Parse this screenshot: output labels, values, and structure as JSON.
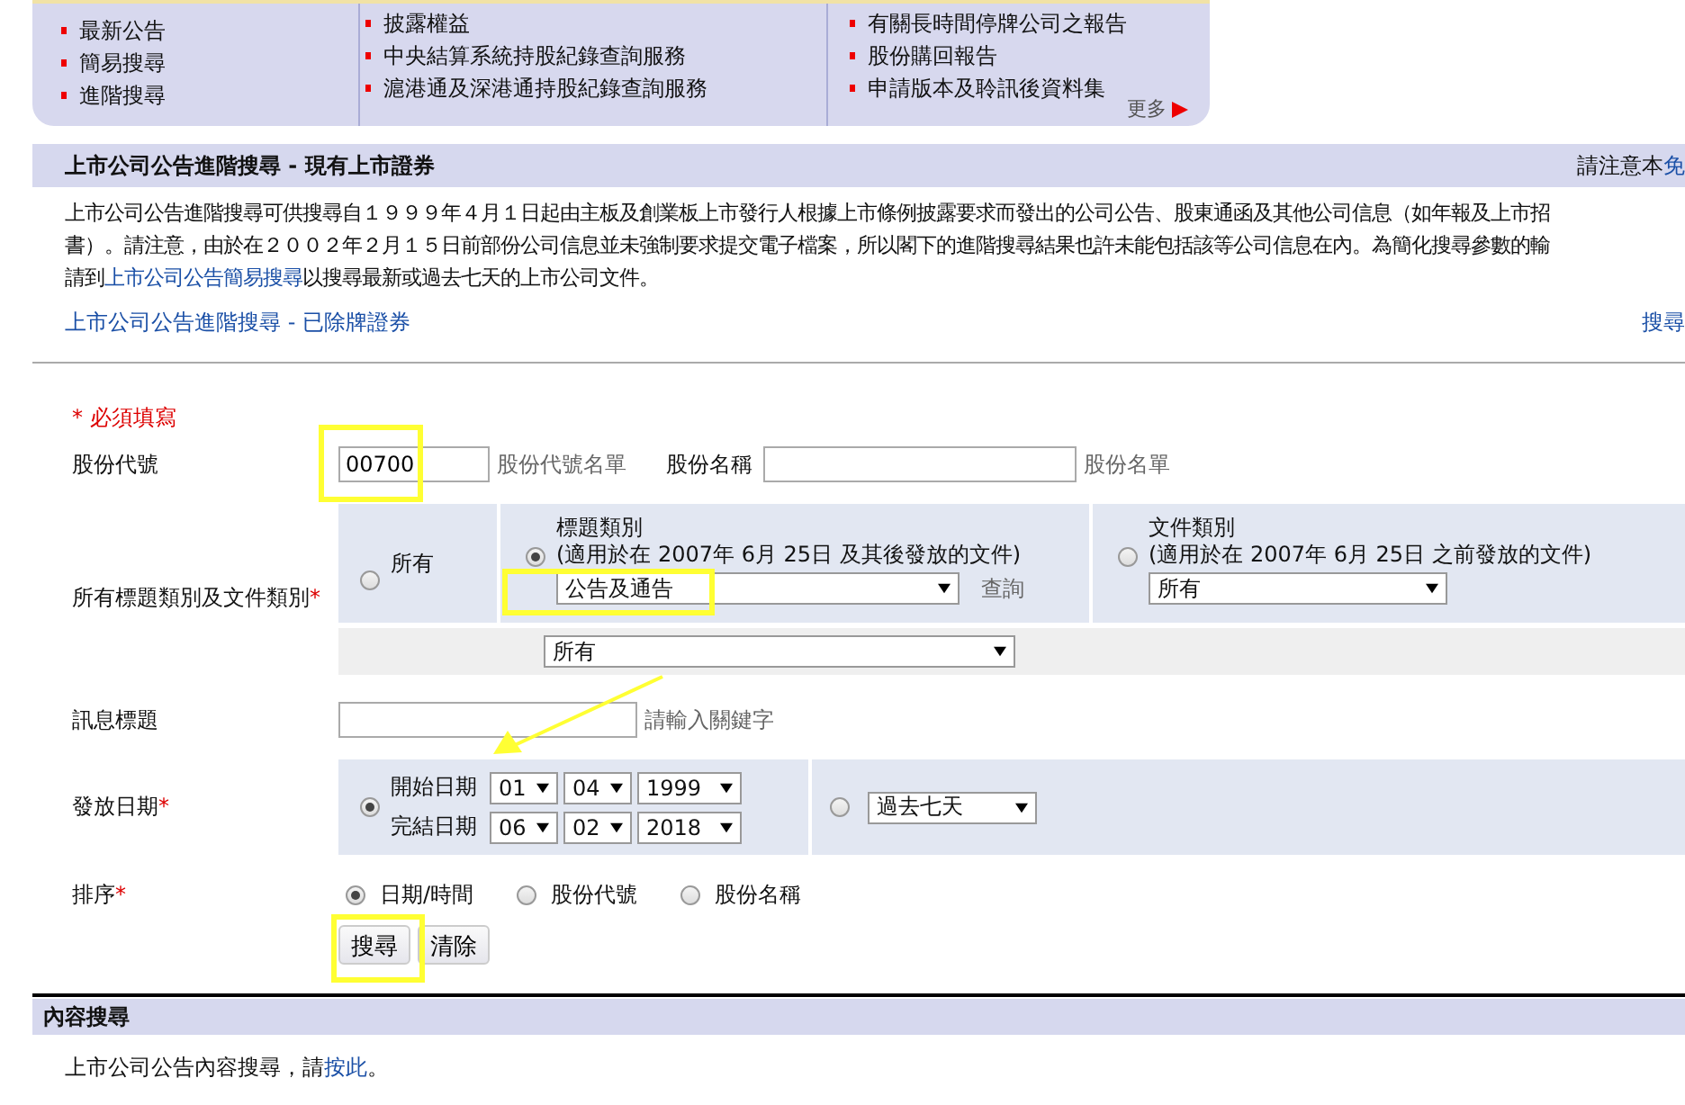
{
  "top_nav": {
    "columns": [
      [
        "最新公告",
        "簡易搜尋",
        "進階搜尋"
      ],
      [
        "披露權益",
        "中央結算系統持股紀錄查詢服務",
        "滬港通及深港通持股紀錄查詢服務"
      ],
      [
        "有關長時間停牌公司之報告",
        "股份購回報告",
        "申請版本及聆訊後資料集"
      ]
    ],
    "more": "更多"
  },
  "section": {
    "title": "上市公司公告進階搜尋 - 現有上市證券",
    "notice": "請注意本",
    "notice_link": "免"
  },
  "intro": {
    "line_1": "上市公司公告進階搜尋可供搜尋自１９９９年４月１日起由主板及創業板上市發行人根據上市條例披露要求而發出的公司公告、股東通函及其他公司信息（如年報及上市招",
    "line_2": "書）。請注意，由於在２００２年２月１５日前部份公司信息並未強制要求提交電子檔案，所以閣下的進階搜尋結果也許未能包括該等公司信息在內。為簡化搜尋參數的輸",
    "line_3_before": "請到",
    "line_3_link": "上市公司公告簡易搜尋",
    "line_3_after": "以搜尋最新或過去七天的上市公司文件。"
  },
  "delisted_link": "上市公司公告進階搜尋 - 已除牌證券",
  "right_link": "搜尋",
  "form": {
    "required_note": "* 必須填寫",
    "stock_code": {
      "label": "股份代號",
      "value": "00700",
      "list_link": "股份代號名單"
    },
    "stock_name": {
      "label": "股份名稱",
      "list_link": "股份名單"
    },
    "category": {
      "label": "所有標題類別及文件類別",
      "required_mark": "*",
      "options": [
        {
          "kind": "all",
          "label": "所有",
          "selected": false
        },
        {
          "kind": "headline",
          "label": "標題類別",
          "note": "(適用於在 2007年 6月 25日 及其後發放的文件)",
          "select": "公告及通告",
          "extra_link": "查詢",
          "selected": true
        },
        {
          "kind": "document",
          "label": "文件類別",
          "note": "(適用於在 2007年 6月 25日 之前發放的文件)",
          "select": "所有",
          "selected": false
        }
      ],
      "sub_select": "所有"
    },
    "title_field": {
      "label": "訊息標題",
      "hint": "請輸入關鍵字"
    },
    "date": {
      "label": "發放日期",
      "required_mark": "*",
      "options": [
        {
          "kind": "range",
          "selected": true,
          "start_label": "開始日期",
          "start": [
            "01",
            "04",
            "1999"
          ],
          "end_label": "完結日期",
          "end": [
            "06",
            "02",
            "2018"
          ]
        },
        {
          "kind": "preset",
          "selected": false,
          "select": "過去七天"
        }
      ]
    },
    "sort": {
      "label": "排序",
      "required_mark": "*",
      "options": [
        {
          "label": "日期/時間",
          "selected": true
        },
        {
          "label": "股份代號",
          "selected": false
        },
        {
          "label": "股份名稱",
          "selected": false
        }
      ]
    },
    "buttons": [
      "搜尋",
      "清除"
    ]
  },
  "content_search": {
    "title": "內容搜尋",
    "text_before": "上市公司公告內容搜尋，請",
    "link": "按此",
    "text_after": "。"
  }
}
